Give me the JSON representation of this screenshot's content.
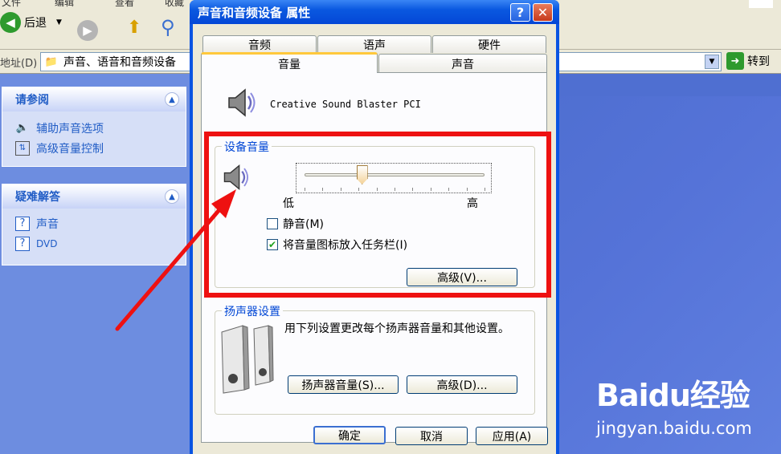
{
  "explorer": {
    "menu": [
      "文件",
      "编辑",
      "查看",
      "收藏"
    ],
    "back_label": "后退",
    "address_label": "地址(D)",
    "address_value": "声音、语音和音频设备",
    "go_label": "转到"
  },
  "panels": [
    {
      "title": "请参阅",
      "items": [
        "辅助声音选项",
        "高级音量控制"
      ]
    },
    {
      "title": "疑难解答",
      "items": [
        "声音",
        "DVD"
      ]
    }
  ],
  "dialog": {
    "title": "声音和音频设备 属性",
    "tabs_back": [
      "音频",
      "语声",
      "硬件"
    ],
    "tabs_front": [
      "音量",
      "声音"
    ],
    "device_name": "Creative Sound Blaster PCI",
    "volume_group": {
      "label": "设备音量",
      "low": "低",
      "high": "高",
      "level_fraction": 0.32,
      "mute_label": "静音(M)",
      "mute_checked": false,
      "tray_label": "将音量图标放入任务栏(I)",
      "tray_checked": true,
      "advanced_label": "高级(V)..."
    },
    "speaker_group": {
      "label": "扬声器设置",
      "description": "用下列设置更改每个扬声器音量和其他设置。",
      "volume_button": "扬声器音量(S)...",
      "advanced_button": "高级(D)..."
    },
    "ok_label": "确定",
    "cancel_label": "取消",
    "apply_label": "应用(A)"
  },
  "watermark": {
    "logo": "Baidu经验",
    "url": "jingyan.baidu.com"
  },
  "colors": {
    "highlight_box": "#ee1111",
    "arrow": "#ee1111",
    "title_bar": "#0a54e2"
  }
}
